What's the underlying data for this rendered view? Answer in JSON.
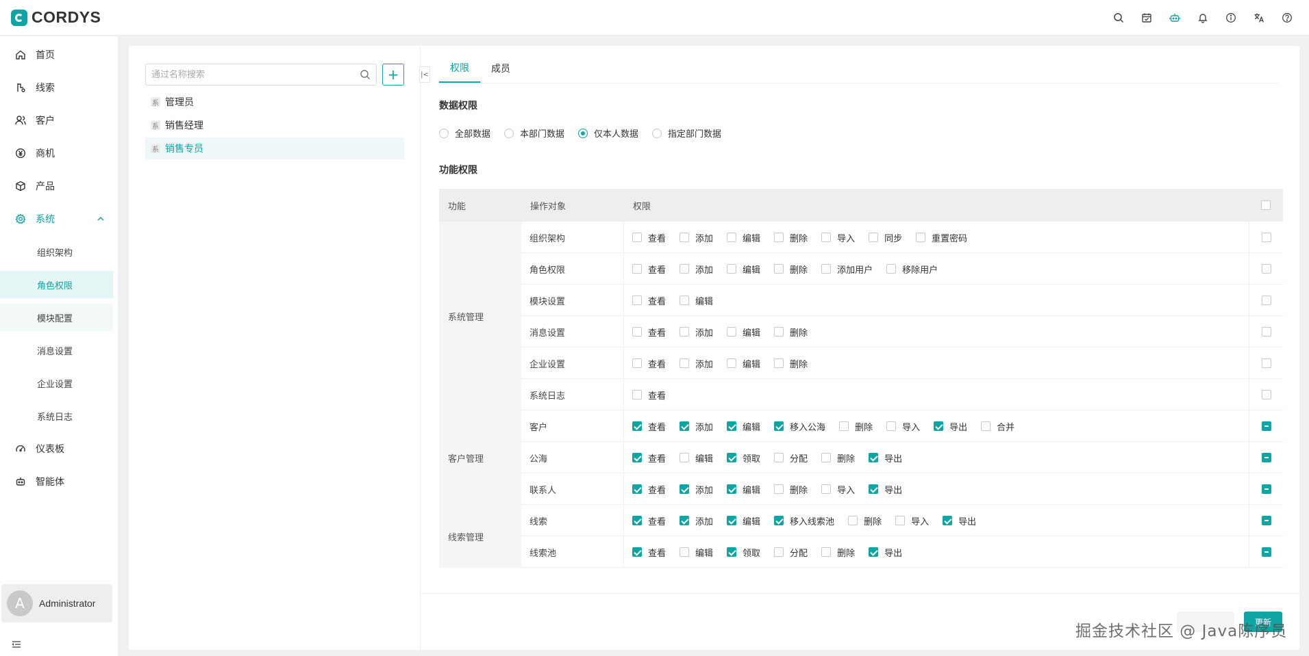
{
  "app": {
    "brand": "CORDYS",
    "header_icons": [
      "search-icon",
      "calendar-icon",
      "robot-icon",
      "bell-icon",
      "info-icon",
      "translate-icon",
      "help-icon"
    ]
  },
  "sidebar": {
    "items": [
      {
        "label": "首页",
        "icon": "home-icon"
      },
      {
        "label": "线索",
        "icon": "lead-icon"
      },
      {
        "label": "客户",
        "icon": "customer-icon"
      },
      {
        "label": "商机",
        "icon": "opportunity-icon"
      },
      {
        "label": "产品",
        "icon": "product-icon"
      },
      {
        "label": "系统",
        "icon": "settings-icon"
      },
      {
        "label": "仪表板",
        "icon": "dashboard-icon"
      },
      {
        "label": "智能体",
        "icon": "agent-icon"
      }
    ],
    "sub_items": [
      "组织架构",
      "角色权限",
      "模块配置",
      "消息设置",
      "企业设置",
      "系统日志"
    ],
    "user": {
      "avatar": "A",
      "name": "Administrator"
    }
  },
  "roles": {
    "search_placeholder": "通过名称搜索",
    "tag": "系",
    "items": [
      "管理员",
      "销售经理",
      "销售专员"
    ],
    "selected": "销售专员"
  },
  "tabs": [
    "权限",
    "成员"
  ],
  "data_permission": {
    "title": "数据权限",
    "options": [
      "全部数据",
      "本部门数据",
      "仅本人数据",
      "指定部门数据"
    ],
    "selected": "仅本人数据"
  },
  "function_permission": {
    "title": "功能权限",
    "headers": {
      "func": "功能",
      "object": "操作对象",
      "perm": "权限"
    },
    "groups": [
      {
        "name": "系统管理",
        "rows": [
          {
            "object": "组织架构",
            "all": "none",
            "perms": [
              [
                "查看",
                false
              ],
              [
                "添加",
                false
              ],
              [
                "编辑",
                false
              ],
              [
                "删除",
                false
              ],
              [
                "导入",
                false
              ],
              [
                "同步",
                false
              ],
              [
                "重置密码",
                false
              ]
            ]
          },
          {
            "object": "角色权限",
            "all": "none",
            "perms": [
              [
                "查看",
                false
              ],
              [
                "添加",
                false
              ],
              [
                "编辑",
                false
              ],
              [
                "删除",
                false
              ],
              [
                "添加用户",
                false
              ],
              [
                "移除用户",
                false
              ]
            ]
          },
          {
            "object": "模块设置",
            "all": "none",
            "perms": [
              [
                "查看",
                false
              ],
              [
                "编辑",
                false
              ]
            ]
          },
          {
            "object": "消息设置",
            "all": "none",
            "perms": [
              [
                "查看",
                false
              ],
              [
                "添加",
                false
              ],
              [
                "编辑",
                false
              ],
              [
                "删除",
                false
              ]
            ]
          },
          {
            "object": "企业设置",
            "all": "none",
            "perms": [
              [
                "查看",
                false
              ],
              [
                "添加",
                false
              ],
              [
                "编辑",
                false
              ],
              [
                "删除",
                false
              ]
            ]
          },
          {
            "object": "系统日志",
            "all": "none",
            "perms": [
              [
                "查看",
                false
              ]
            ]
          }
        ]
      },
      {
        "name": "客户管理",
        "rows": [
          {
            "object": "客户",
            "all": "partial",
            "perms": [
              [
                "查看",
                true
              ],
              [
                "添加",
                true
              ],
              [
                "编辑",
                true
              ],
              [
                "移入公海",
                true
              ],
              [
                "删除",
                false
              ],
              [
                "导入",
                false
              ],
              [
                "导出",
                true
              ],
              [
                "合并",
                false
              ]
            ]
          },
          {
            "object": "公海",
            "all": "partial",
            "perms": [
              [
                "查看",
                true
              ],
              [
                "编辑",
                false
              ],
              [
                "领取",
                true
              ],
              [
                "分配",
                false
              ],
              [
                "删除",
                false
              ],
              [
                "导出",
                true
              ]
            ]
          },
          {
            "object": "联系人",
            "all": "partial",
            "perms": [
              [
                "查看",
                true
              ],
              [
                "添加",
                true
              ],
              [
                "编辑",
                true
              ],
              [
                "删除",
                false
              ],
              [
                "导入",
                false
              ],
              [
                "导出",
                true
              ]
            ]
          }
        ]
      },
      {
        "name": "线索管理",
        "rows": [
          {
            "object": "线索",
            "all": "partial",
            "perms": [
              [
                "查看",
                true
              ],
              [
                "添加",
                true
              ],
              [
                "编辑",
                true
              ],
              [
                "移入线索池",
                true
              ],
              [
                "删除",
                false
              ],
              [
                "导入",
                false
              ],
              [
                "导出",
                true
              ]
            ]
          },
          {
            "object": "线索池",
            "all": "partial",
            "perms": [
              [
                "查看",
                true
              ],
              [
                "编辑",
                false
              ],
              [
                "领取",
                true
              ],
              [
                "分配",
                false
              ],
              [
                "删除",
                false
              ],
              [
                "导出",
                true
              ]
            ]
          }
        ]
      }
    ]
  },
  "footer": {
    "save_label": "更新"
  },
  "watermark": "掘金技术社区 @ Java陈序员",
  "colors": {
    "accent": "#0fa5a5"
  }
}
